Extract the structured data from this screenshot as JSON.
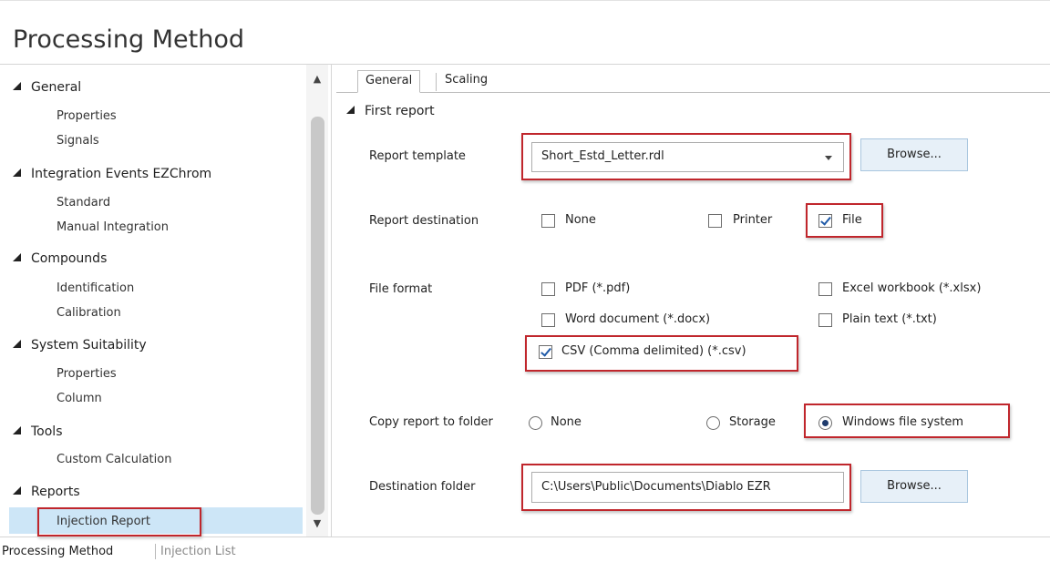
{
  "window": {
    "title": "Processing Method"
  },
  "nav": {
    "sections": [
      {
        "label": "General",
        "items": [
          "Properties",
          "Signals"
        ]
      },
      {
        "label": "Integration Events EZChrom",
        "items": [
          "Standard",
          "Manual Integration"
        ]
      },
      {
        "label": "Compounds",
        "items": [
          "Identification",
          "Calibration"
        ]
      },
      {
        "label": "System Suitability",
        "items": [
          "Properties",
          "Column"
        ]
      },
      {
        "label": "Tools",
        "items": [
          "Custom Calculation"
        ]
      },
      {
        "label": "Reports",
        "items": [
          "Injection Report"
        ]
      }
    ],
    "selected_item": "Injection Report"
  },
  "tabs": {
    "general": "General",
    "scaling": "Scaling",
    "active": "General"
  },
  "first_report": {
    "group_label": "First report",
    "report_template": {
      "label": "Report template",
      "value": "Short_Estd_Letter.rdl",
      "browse": "Browse..."
    },
    "report_destination": {
      "label": "Report destination",
      "none": {
        "label": "None",
        "checked": false
      },
      "printer": {
        "label": "Printer",
        "checked": false
      },
      "file": {
        "label": "File",
        "checked": true
      }
    },
    "file_format": {
      "label": "File format",
      "pdf": {
        "label": "PDF (*.pdf)",
        "checked": false
      },
      "excel": {
        "label": "Excel workbook (*.xlsx)",
        "checked": false
      },
      "word": {
        "label": "Word document (*.docx)",
        "checked": false
      },
      "plain": {
        "label": "Plain text (*.txt)",
        "checked": false
      },
      "csv": {
        "label": "CSV (Comma delimited) (*.csv)",
        "checked": true
      }
    },
    "copy_to_folder": {
      "label": "Copy report to folder",
      "none": "None",
      "storage": "Storage",
      "windows": "Windows file system",
      "selected": "Windows file system"
    },
    "destination_folder": {
      "label": "Destination folder",
      "value": "C:\\Users\\Public\\Documents\\Diablo EZR",
      "browse": "Browse..."
    }
  },
  "bottom_tabs": {
    "processing_method": "Processing Method",
    "injection_list": "Injection List",
    "active": "Processing Method"
  },
  "colors": {
    "highlight": "#c0262c",
    "selection": "#cde6f7",
    "button": "#e7f0f8"
  }
}
